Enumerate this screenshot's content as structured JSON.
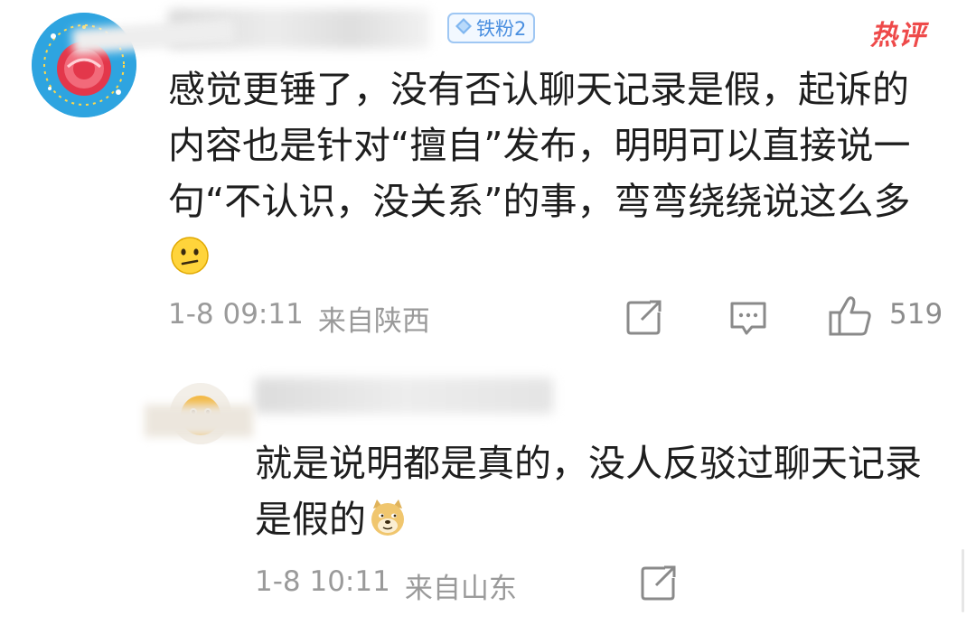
{
  "main_comment": {
    "fan_badge": "铁粉2",
    "hot_label": "热评",
    "text": "感觉更锤了，没有否认聊天记录是假，起诉的内容也是针对“擅自”发布，明明可以直接说一句“不认识，没关系”的事，弯弯绕绕说这么多",
    "emoji": "confused-face",
    "date": "1-8 09:11",
    "location": "来自陕西",
    "like_count": "519"
  },
  "reply": {
    "text": "就是说明都是真的，没人反驳过聊天记录是假的",
    "emoji": "doge-face",
    "date": "1-8 10:11",
    "location": "来自山东"
  },
  "icons": {
    "share": "share-icon",
    "comment": "comment-icon",
    "like": "thumbs-up-icon",
    "badge_diamond": "diamond-icon"
  },
  "colors": {
    "hot": "#ee4a4a",
    "badge": "#4a8fe0",
    "meta": "#9a9a9a",
    "avatar_bg": "#2ea4e0"
  }
}
